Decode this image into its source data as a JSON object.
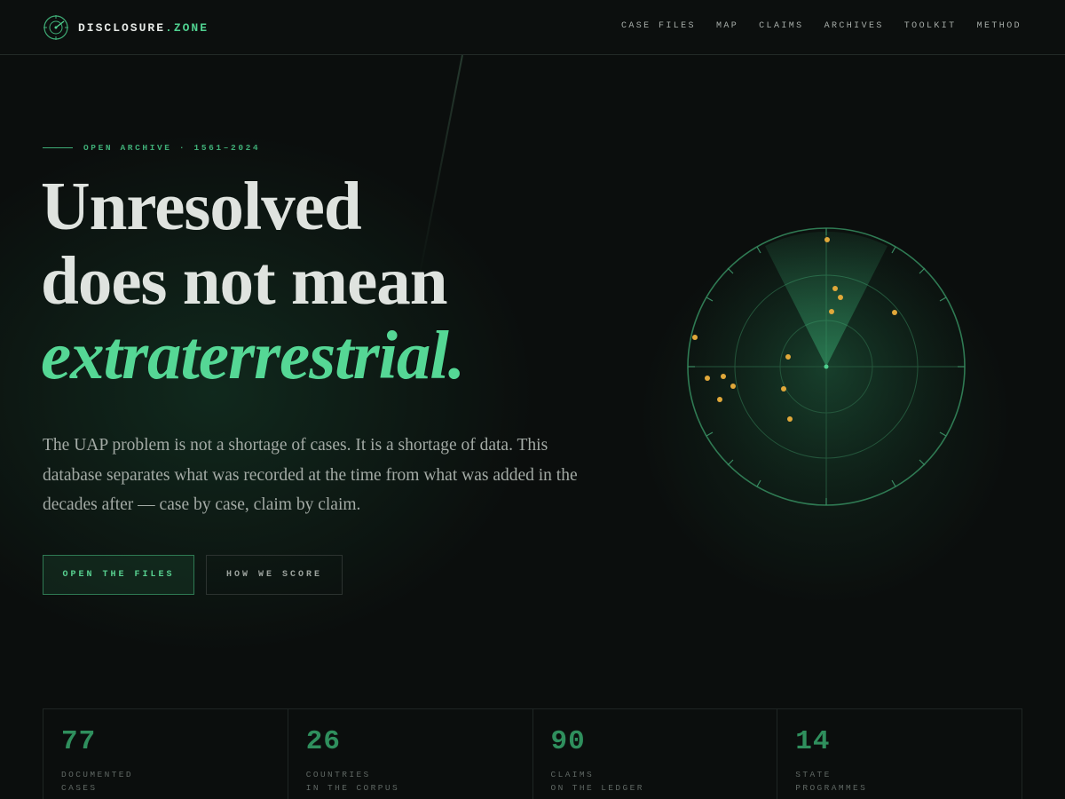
{
  "header": {
    "logo_main": "DISCLOSURE",
    "logo_accent": ".ZONE",
    "nav": [
      "CASE FILES",
      "MAP",
      "CLAIMS",
      "ARCHIVES",
      "TOOLKIT",
      "METHOD"
    ]
  },
  "hero": {
    "eyebrow": "OPEN ARCHIVE · 1561–2024",
    "headline_line1": "Unresolved",
    "headline_line2": "does not mean",
    "headline_accent": "extraterrestrial.",
    "lede": "The UAP problem is not a shortage of cases. It is a shortage of data. This database separates what was recorded at the time from what was added in the decades after — case by case, claim by claim.",
    "primary_button": "OPEN THE FILES",
    "secondary_button": "HOW WE SCORE"
  },
  "radar": {
    "icon": "radar-scope",
    "accent_color": "#4fd08f",
    "blip_color": "#e0a83a"
  },
  "stats": [
    {
      "value": "77",
      "label_line1": "DOCUMENTED",
      "label_line2": "CASES"
    },
    {
      "value": "26",
      "label_line1": "COUNTRIES",
      "label_line2": "IN THE CORPUS"
    },
    {
      "value": "90",
      "label_line1": "CLAIMS",
      "label_line2": "ON THE LEDGER"
    },
    {
      "value": "14",
      "label_line1": "STATE",
      "label_line2": "PROGRAMMES"
    }
  ]
}
